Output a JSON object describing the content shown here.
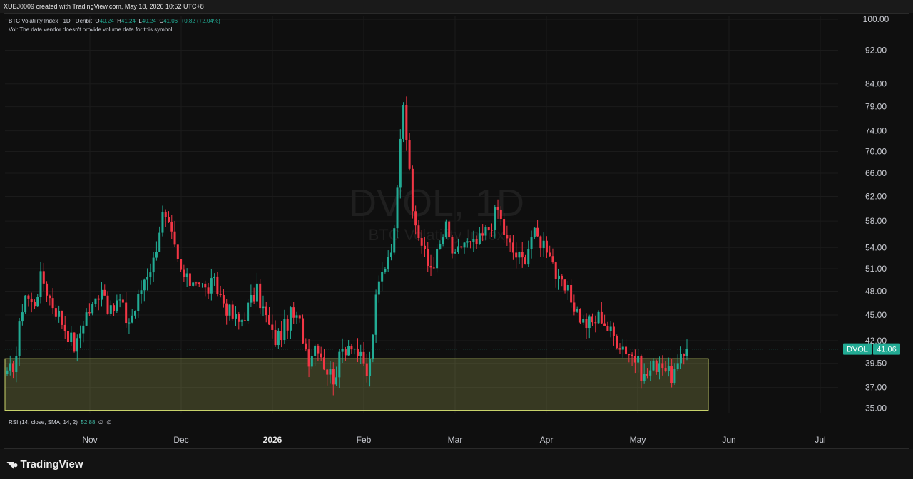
{
  "header": {
    "credit": "XUEJ0009 created with TradingView.com, May 18, 2026 10:52 UTC+8"
  },
  "legend": {
    "symbol": "BTC Volatility Index · 1D · Deribit",
    "o_label": "O",
    "o": "40.24",
    "h_label": "H",
    "h": "41.24",
    "l_label": "L",
    "l": "40.24",
    "c_label": "C",
    "c": "41.06",
    "change": "+0.82 (+2.04%)",
    "vol_note": "Vol: The data vendor doesn't provide volume data for this symbol."
  },
  "watermark": {
    "ticker": "DVOL, 1D",
    "name": "BTC Volatility Index"
  },
  "rsi": {
    "label": "RSI (14, close, SMA, 14, 2)",
    "value": "52.88",
    "extra1": "∅",
    "extra2": "∅"
  },
  "brand": {
    "name": "TradingView"
  },
  "colors": {
    "up": "#22ab94",
    "down": "#f23645",
    "zone": "#c9d26b",
    "bg": "#0f0f0f",
    "badge": "#22ab94"
  },
  "chart_data": {
    "type": "candlestick",
    "y_scale": "log",
    "ylim": [
      34.5,
      101
    ],
    "y_ticks": [
      "100.00",
      "92.00",
      "84.00",
      "79.00",
      "74.00",
      "70.00",
      "66.00",
      "62.00",
      "58.00",
      "54.00",
      "51.00",
      "48.00",
      "45.00",
      "42.00",
      "39.50",
      "37.00",
      "35.00"
    ],
    "x_ticks": [
      {
        "label": "Nov",
        "bold": false
      },
      {
        "label": "Dec",
        "bold": false
      },
      {
        "label": "2026",
        "bold": true
      },
      {
        "label": "Feb",
        "bold": false
      },
      {
        "label": "Mar",
        "bold": false
      },
      {
        "label": "Apr",
        "bold": false
      },
      {
        "label": "May",
        "bold": false
      },
      {
        "label": "Jun",
        "bold": false
      },
      {
        "label": "Jul",
        "bold": false
      }
    ],
    "last_price": {
      "label": "DVOL",
      "value": "41.06"
    },
    "zone": {
      "y_top": 40.0,
      "y_bottom": 34.8
    },
    "close_path": [
      38,
      40,
      48,
      46,
      50,
      47,
      45,
      43,
      41,
      45,
      46,
      49,
      45,
      47,
      44,
      46,
      50,
      52,
      59,
      56,
      51,
      49,
      50,
      48,
      49,
      47,
      45,
      44,
      46,
      48,
      45,
      42,
      43,
      45,
      44,
      40,
      42,
      39,
      38,
      41,
      42,
      40,
      38,
      48,
      52,
      56,
      82,
      60,
      55,
      51,
      53,
      57,
      52,
      55,
      54,
      55,
      57,
      60,
      55,
      53,
      52,
      56,
      55,
      54,
      49,
      48,
      46,
      44,
      44,
      45,
      43,
      42,
      41,
      40,
      38,
      39,
      40,
      38,
      39,
      41
    ]
  }
}
